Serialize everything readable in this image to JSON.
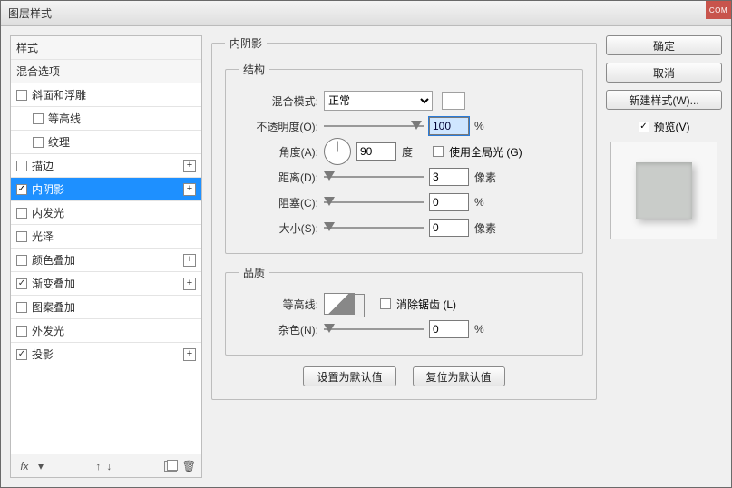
{
  "window": {
    "title": "图层样式",
    "corner": "COM"
  },
  "left": {
    "header1": "样式",
    "header2": "混合选项",
    "items": [
      {
        "label": "斜面和浮雕",
        "checked": false,
        "plus": false,
        "indent": false
      },
      {
        "label": "等高线",
        "checked": false,
        "plus": false,
        "indent": true
      },
      {
        "label": "纹理",
        "checked": false,
        "plus": false,
        "indent": true
      },
      {
        "label": "描边",
        "checked": false,
        "plus": true,
        "indent": false
      },
      {
        "label": "内阴影",
        "checked": true,
        "plus": true,
        "indent": false,
        "selected": true
      },
      {
        "label": "内发光",
        "checked": false,
        "plus": false,
        "indent": false
      },
      {
        "label": "光泽",
        "checked": false,
        "plus": false,
        "indent": false
      },
      {
        "label": "颜色叠加",
        "checked": false,
        "plus": true,
        "indent": false
      },
      {
        "label": "渐变叠加",
        "checked": true,
        "plus": true,
        "indent": false
      },
      {
        "label": "图案叠加",
        "checked": false,
        "plus": false,
        "indent": false
      },
      {
        "label": "外发光",
        "checked": false,
        "plus": false,
        "indent": false
      },
      {
        "label": "投影",
        "checked": true,
        "plus": true,
        "indent": false
      }
    ],
    "footer": {
      "fx": "fx"
    }
  },
  "panel": {
    "title": "内阴影",
    "structure": {
      "legend": "结构",
      "blendLabel": "混合模式:",
      "blendValue": "正常",
      "opacityLabel": "不透明度(O):",
      "opacityValue": "100",
      "opacityUnit": "%",
      "angleLabel": "角度(A):",
      "angleValue": "90",
      "angleUnit": "度",
      "globalLabel": "使用全局光 (G)",
      "globalChecked": false,
      "distanceLabel": "距离(D):",
      "distanceValue": "3",
      "distanceUnit": "像素",
      "chokeLabel": "阻塞(C):",
      "chokeValue": "0",
      "chokeUnit": "%",
      "sizeLabel": "大小(S):",
      "sizeValue": "0",
      "sizeUnit": "像素"
    },
    "quality": {
      "legend": "品质",
      "contourLabel": "等高线:",
      "antiAliasLabel": "消除锯齿 (L)",
      "antiAliasChecked": false,
      "noiseLabel": "杂色(N):",
      "noiseValue": "0",
      "noiseUnit": "%"
    },
    "buttons": {
      "setDefault": "设置为默认值",
      "resetDefault": "复位为默认值"
    }
  },
  "right": {
    "ok": "确定",
    "cancel": "取消",
    "newStyle": "新建样式(W)...",
    "previewLabel": "预览(V)",
    "previewChecked": true
  }
}
